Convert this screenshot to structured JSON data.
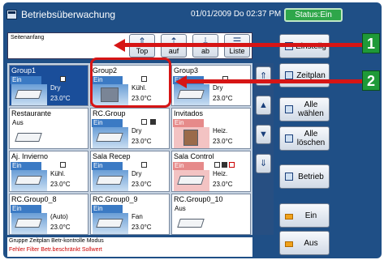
{
  "titlebar": {
    "title": "Betriebsüberwachung",
    "datetime": "01/01/2009 Do 02:37 PM",
    "status": "Status:Ein"
  },
  "page_header": {
    "text": "Seitenanfang"
  },
  "nav": [
    {
      "glyph": "⇑",
      "label": "Top"
    },
    {
      "glyph": "⇡",
      "label": "auf"
    },
    {
      "glyph": "⇣",
      "label": "ab"
    },
    {
      "glyph": "☰",
      "label": "Liste"
    }
  ],
  "tiles": [
    {
      "name": "Group1",
      "state": "Ein",
      "mode": "Dry",
      "temp": "23.0°C",
      "selected": true
    },
    {
      "name": "Group2",
      "state": "Ein",
      "mode": "Kühl.",
      "temp": "23.0°C"
    },
    {
      "name": "Group3",
      "state": "Ein",
      "mode": "Dry",
      "temp": "23.0°C"
    },
    {
      "name": "Restaurante",
      "state": "Aus",
      "mode": "",
      "temp": ""
    },
    {
      "name": "RC.Group",
      "state": "Ein",
      "mode": "Dry",
      "temp": "23.0°C"
    },
    {
      "name": "Invitados",
      "state": "Ein",
      "mode": "Heiz.",
      "temp": "23.0°C"
    },
    {
      "name": "Aj. Invierno",
      "state": "Ein",
      "mode": "Kühl.",
      "temp": "23.0°C"
    },
    {
      "name": "Sala Recep",
      "state": "Ein",
      "mode": "Dry",
      "temp": "23.0°C"
    },
    {
      "name": "Sala Control",
      "state": "Ein",
      "mode": "Heiz.",
      "temp": "23.0°C"
    },
    {
      "name": "RC.Group0_8",
      "state": "Ein",
      "mode": "(Auto)",
      "temp": "23.0°C"
    },
    {
      "name": "RC.Group0_9",
      "state": "Ein",
      "mode": "Fan",
      "temp": "23.0°C"
    },
    {
      "name": "RC.Group0_10",
      "state": "Aus",
      "mode": "",
      "temp": ""
    }
  ],
  "side": {
    "einstellung": "Einstellg",
    "zeitplan": "Zeitplan",
    "alle_waehlen": "Alle wählen",
    "alle_loeschen": "Alle löschen",
    "betrieb": "Betrieb",
    "ein": "Ein",
    "aus": "Aus"
  },
  "legend": {
    "row1": "Gruppe  Zeitplan  Betr-kontrolle  Modus",
    "row2": "Fehler  Filter  Betr.beschränkt  Sollwert"
  },
  "callouts": [
    "1",
    "2"
  ],
  "colors": {
    "background": "#1f4f86",
    "status": "#2ea64a",
    "callout": "#d61515",
    "badge": "#1f9a38"
  }
}
